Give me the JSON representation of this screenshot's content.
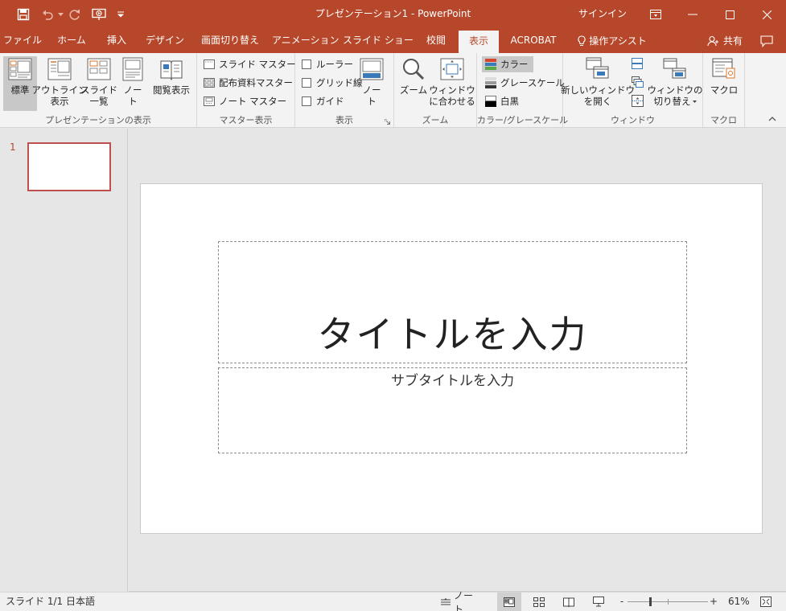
{
  "window": {
    "title": "プレゼンテーション1  -  PowerPoint",
    "signin": "サインイン",
    "accent": "#b7472a"
  },
  "qat": {
    "icons": [
      "save-icon",
      "undo-icon",
      "undo-dropdown-icon",
      "redo-icon",
      "present-from-start-icon",
      "customize-qat-icon"
    ]
  },
  "tabs": [
    "ファイル",
    "ホーム",
    "挿入",
    "デザイン",
    "画面切り替え",
    "アニメーション",
    "スライド ショー",
    "校閲",
    "表示",
    "ACROBAT"
  ],
  "active_tab": "表示",
  "tell_me": "操作アシスト",
  "share": "共有",
  "ribbon": {
    "presentation_views": {
      "label": "プレゼンテーションの表示",
      "normal": "標準",
      "outline_1": "アウトライン",
      "outline_2": "表示",
      "sorter_1": "スライド",
      "sorter_2": "一覧",
      "notes_1": "ノー",
      "notes_2": "ト",
      "reading": "閲覧表示"
    },
    "master_views": {
      "label": "マスター表示",
      "slide_master": "スライド マスター",
      "handout_master": "配布資料マスター",
      "notes_master": "ノート マスター"
    },
    "show": {
      "label": "表示",
      "ruler": "ルーラー",
      "gridlines": "グリッド線",
      "guides": "ガイド",
      "notes_1": "ノー",
      "notes_2": "ト"
    },
    "zoom": {
      "label": "ズーム",
      "zoom": "ズーム",
      "fit_1": "ウィンドウ",
      "fit_2": "に合わせる"
    },
    "color": {
      "label": "カラー/グレースケール",
      "color": "カラー",
      "grayscale": "グレースケール",
      "bw": "白黒"
    },
    "window": {
      "label": "ウィンドウ",
      "new_window_1": "新しいウィンドウ",
      "new_window_2": "を開く",
      "switch_1": "ウィンドウの",
      "switch_2": "切り替え"
    },
    "macros": {
      "label": "マクロ",
      "macros": "マクロ"
    }
  },
  "slides_pane": {
    "number": "1"
  },
  "slide": {
    "title_placeholder": "タイトルを入力",
    "subtitle_placeholder": "サブタイトルを入力"
  },
  "status": {
    "slide_count": "スライド 1/1",
    "language": "日本語",
    "notes": "ノート",
    "zoom_minus": "-",
    "zoom_plus": "+",
    "zoom_level": "61%",
    "zoom_fraction": 0.61
  }
}
